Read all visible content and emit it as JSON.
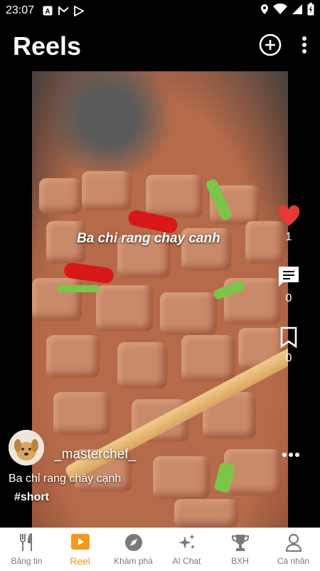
{
  "status_bar": {
    "time": "23:07"
  },
  "app_bar": {
    "title": "Reels"
  },
  "video": {
    "overlay_caption": "Ba chi rang chay canh",
    "likes": "1",
    "comments": "0",
    "saves": "0",
    "author": "_masterchef_",
    "description": "Ba chỉ rang cháy cạnh",
    "hashtag": "#short"
  },
  "bottom_nav": {
    "items": [
      {
        "label": "Bảng tin",
        "icon": "cutlery-icon"
      },
      {
        "label": "Reel",
        "icon": "play-icon"
      },
      {
        "label": "Khám phá",
        "icon": "compass-icon"
      },
      {
        "label": "AI Chat",
        "icon": "sparkle-icon"
      },
      {
        "label": "BXH",
        "icon": "trophy-icon"
      },
      {
        "label": "Cá nhân",
        "icon": "user-icon"
      }
    ],
    "active_color": "#F39A1F",
    "inactive_color": "#7A7A7A"
  },
  "colors": {
    "like": "#E53935"
  }
}
